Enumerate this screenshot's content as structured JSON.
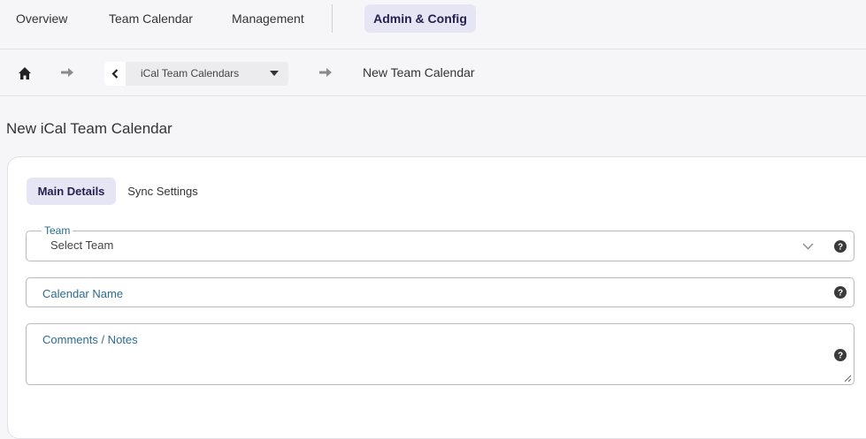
{
  "nav": {
    "items": [
      "Overview",
      "Team Calendar",
      "Management"
    ],
    "active": "Admin & Config"
  },
  "breadcrumb": {
    "parent_select": "iCal Team Calendars",
    "current": "New Team Calendar"
  },
  "page": {
    "title": "New iCal Team Calendar"
  },
  "tabs": [
    "Main Details",
    "Sync Settings"
  ],
  "form": {
    "team_label": "Team",
    "team_value": "Select Team",
    "calendar_name_label": "Calendar Name",
    "notes_label": "Comments / Notes"
  },
  "colors": {
    "accent_bg": "#e6e5f3",
    "accent_text": "#26214e",
    "label_blue": "#2b6c8f"
  },
  "icons": [
    "home-icon",
    "arrow-right-icon",
    "chevron-left-icon",
    "caret-down-icon",
    "chevron-down-icon",
    "help-icon",
    "resize-handle-icon"
  ]
}
